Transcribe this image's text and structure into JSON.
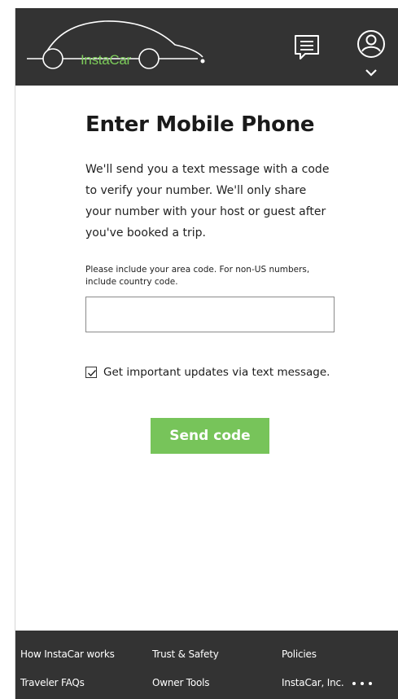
{
  "header": {
    "logo_text": "InstaCar",
    "chat_icon": "chat-icon",
    "account_icon": "user-account-icon",
    "dropdown_icon": "chevron-down-icon"
  },
  "main": {
    "title": "Enter Mobile Phone",
    "description": "We'll send you a text message with a code to verify your number. We'll only share your number with your host or guest after you've booked a trip.",
    "hint": "Please include your area code. For non-US numbers, include country code.",
    "phone_value": "",
    "phone_placeholder": "",
    "checkbox_checked": true,
    "checkbox_label": "Get important updates via text message.",
    "send_button": "Send code"
  },
  "footer": {
    "links": [
      "How InstaCar works",
      "Trust & Safety",
      "Policies",
      "Traveler FAQs",
      "Owner Tools",
      "InstaCar, Inc."
    ],
    "more_icon": "more-ellipsis-icon"
  },
  "colors": {
    "header_bg": "#333333",
    "accent_green": "#77c45a",
    "footer_bg": "#333333"
  }
}
